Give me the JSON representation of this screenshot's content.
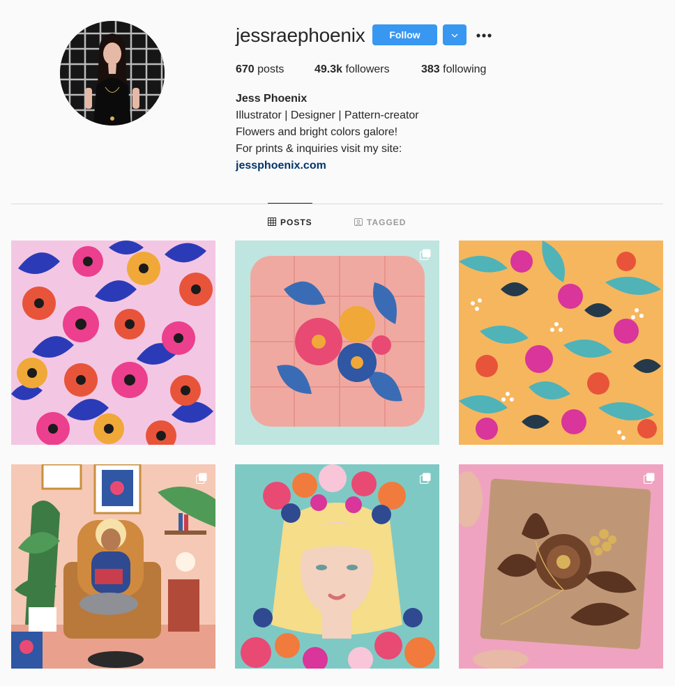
{
  "profile": {
    "username": "jessraephoenix",
    "follow_label": "Follow",
    "stats": {
      "posts_count": "670",
      "posts_label": "posts",
      "followers_count": "49.3k",
      "followers_label": "followers",
      "following_count": "383",
      "following_label": "following"
    },
    "bio": {
      "name": "Jess Phoenix",
      "line1": "Illustrator | Designer | Pattern-creator",
      "line2": "Flowers and bright colors galore!",
      "line3": "For prints & inquiries visit my site:",
      "link": "jessphoenix.com"
    }
  },
  "tabs": [
    {
      "label": "POSTS",
      "icon": "grid-icon",
      "active": true
    },
    {
      "label": "TAGGED",
      "icon": "tag-icon",
      "active": false
    }
  ],
  "posts": [
    {
      "subject": "floral pattern (pink, orange, blue)",
      "multiple": false
    },
    {
      "subject": "painted quilted pink box",
      "multiple": true
    },
    {
      "subject": "floral pattern (orange background)",
      "multiple": false
    },
    {
      "subject": "woman reading with cats illustration",
      "multiple": true
    },
    {
      "subject": "blonde woman flower crown portrait",
      "multiple": true
    },
    {
      "subject": "wood inlay flower tile",
      "multiple": true
    }
  ],
  "colors": {
    "accent": "#3897f0",
    "link": "#003569",
    "text": "#262626",
    "muted": "#999999",
    "background": "#fafafa"
  }
}
